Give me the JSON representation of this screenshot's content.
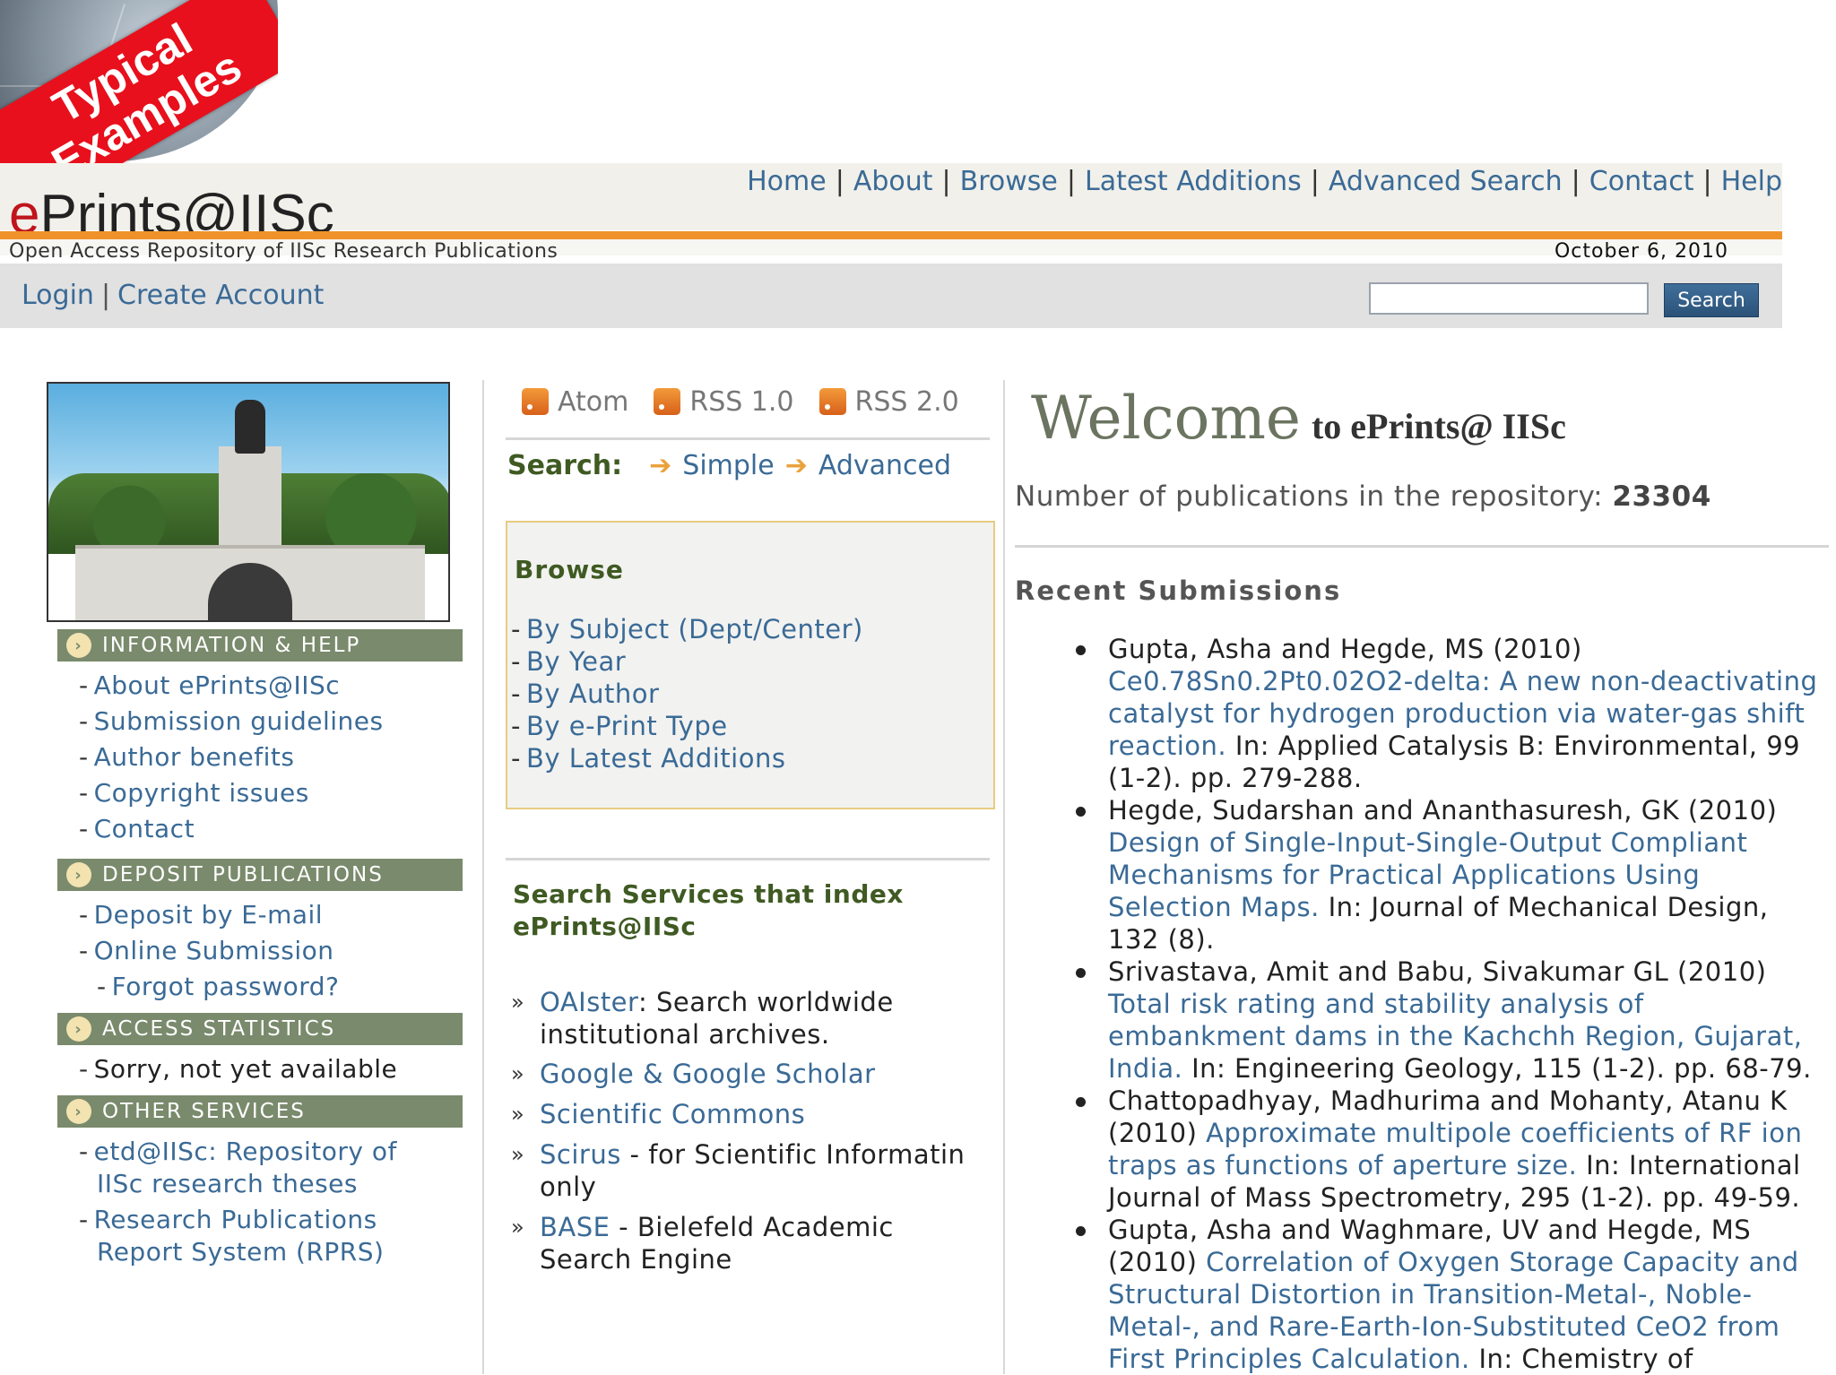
{
  "badge": {
    "line1": "Typical",
    "line2": "Examples"
  },
  "header": {
    "logo_e": "e",
    "logo_rest": "Prints@IISc",
    "subtitle": "Open Access Repository of IISc Research Publications",
    "date": "October 6, 2010",
    "nav": [
      "Home",
      "About",
      "Browse",
      "Latest Additions",
      "Advanced Search",
      "Contact",
      "Help"
    ],
    "login": "Login",
    "create_account": "Create Account",
    "search_value": "",
    "search_button": "Search"
  },
  "left": {
    "sections": [
      {
        "title": "INFORMATION & HELP",
        "items": [
          "About ePrints@IISc",
          "Submission guidelines",
          "Author benefits",
          "Copyright issues",
          "Contact"
        ]
      },
      {
        "title": "DEPOSIT PUBLICATIONS",
        "items": [
          "Deposit by E-mail",
          "Online Submission",
          "Forgot password?"
        ]
      },
      {
        "title": "ACCESS STATISTICS",
        "items": [
          "Sorry, not yet available"
        ]
      },
      {
        "title": "OTHER SERVICES",
        "items": [
          "etd@IISc: Repository of",
          "IISc research theses",
          "Research Publications",
          "Report System (RPRS)"
        ]
      }
    ]
  },
  "middle": {
    "feeds": [
      "Atom",
      "RSS 1.0",
      "RSS 2.0"
    ],
    "search_label": "Search:",
    "search_simple": "Simple",
    "search_advanced": "Advanced",
    "browse_title": "Browse",
    "browse_items": [
      "By Subject (Dept/Center)",
      "By Year",
      "By Author",
      "By e-Print Type",
      "By Latest Additions"
    ],
    "services_title_1": "Search Services that index",
    "services_title_2": "ePrints@IISc",
    "services": [
      {
        "link": "OAIster",
        "text": ": Search worldwide",
        "text2": "institutional archives."
      },
      {
        "link": "Google & Google Scholar",
        "text": "",
        "text2": ""
      },
      {
        "link": "Scientific Commons",
        "text": "",
        "text2": ""
      },
      {
        "link": "Scirus",
        "text": " - for Scientific Informatin",
        "text2": "only"
      },
      {
        "link": "BASE",
        "text": " - Bielefeld Academic",
        "text2": "Search Engine"
      }
    ]
  },
  "right": {
    "welcome_big": "Welcome",
    "welcome_small": "to ePrints@ IISc",
    "pubcount_label": "Number of publications in the repository:",
    "pubcount_value": "23304",
    "recent_title": "Recent Submissions",
    "recent": [
      {
        "authors": "Gupta, Asha and Hegde, MS (2010)",
        "title": "Ce0.78Sn0.2Pt0.02O2-delta: A new non-deactivating catalyst for hydrogen production via water-gas shift reaction.",
        "venue": "In: Applied Catalysis B: Environmental, 99 (1-2). pp. 279-288."
      },
      {
        "authors": "Hegde, Sudarshan and Ananthasuresh, GK (2010)",
        "title": "Design of Single-Input-Single-Output Compliant Mechanisms for Practical Applications Using Selection Maps.",
        "venue": "In: Journal of Mechanical Design, 132 (8)."
      },
      {
        "authors": "Srivastava, Amit and Babu, Sivakumar GL (2010)",
        "title": "Total risk rating and stability analysis of embankment dams in the Kachchh Region, Gujarat, India.",
        "venue": "In: Engineering Geology, 115 (1-2). pp. 68-79."
      },
      {
        "authors": "Chattopadhyay, Madhurima and Mohanty, Atanu K (2010)",
        "title": "Approximate multipole coefficients of RF ion traps as functions of aperture size.",
        "venue": "In: International Journal of Mass Spectrometry, 295 (1-2). pp. 49-59."
      },
      {
        "authors": "Gupta, Asha and Waghmare, UV and Hegde, MS (2010)",
        "title": "Correlation of Oxygen Storage Capacity and Structural Distortion in Transition-Metal-, Noble-Metal-, and Rare-Earth-Ion-Substituted CeO2 from First Principles Calculation.",
        "venue": "In: Chemistry of"
      }
    ]
  }
}
